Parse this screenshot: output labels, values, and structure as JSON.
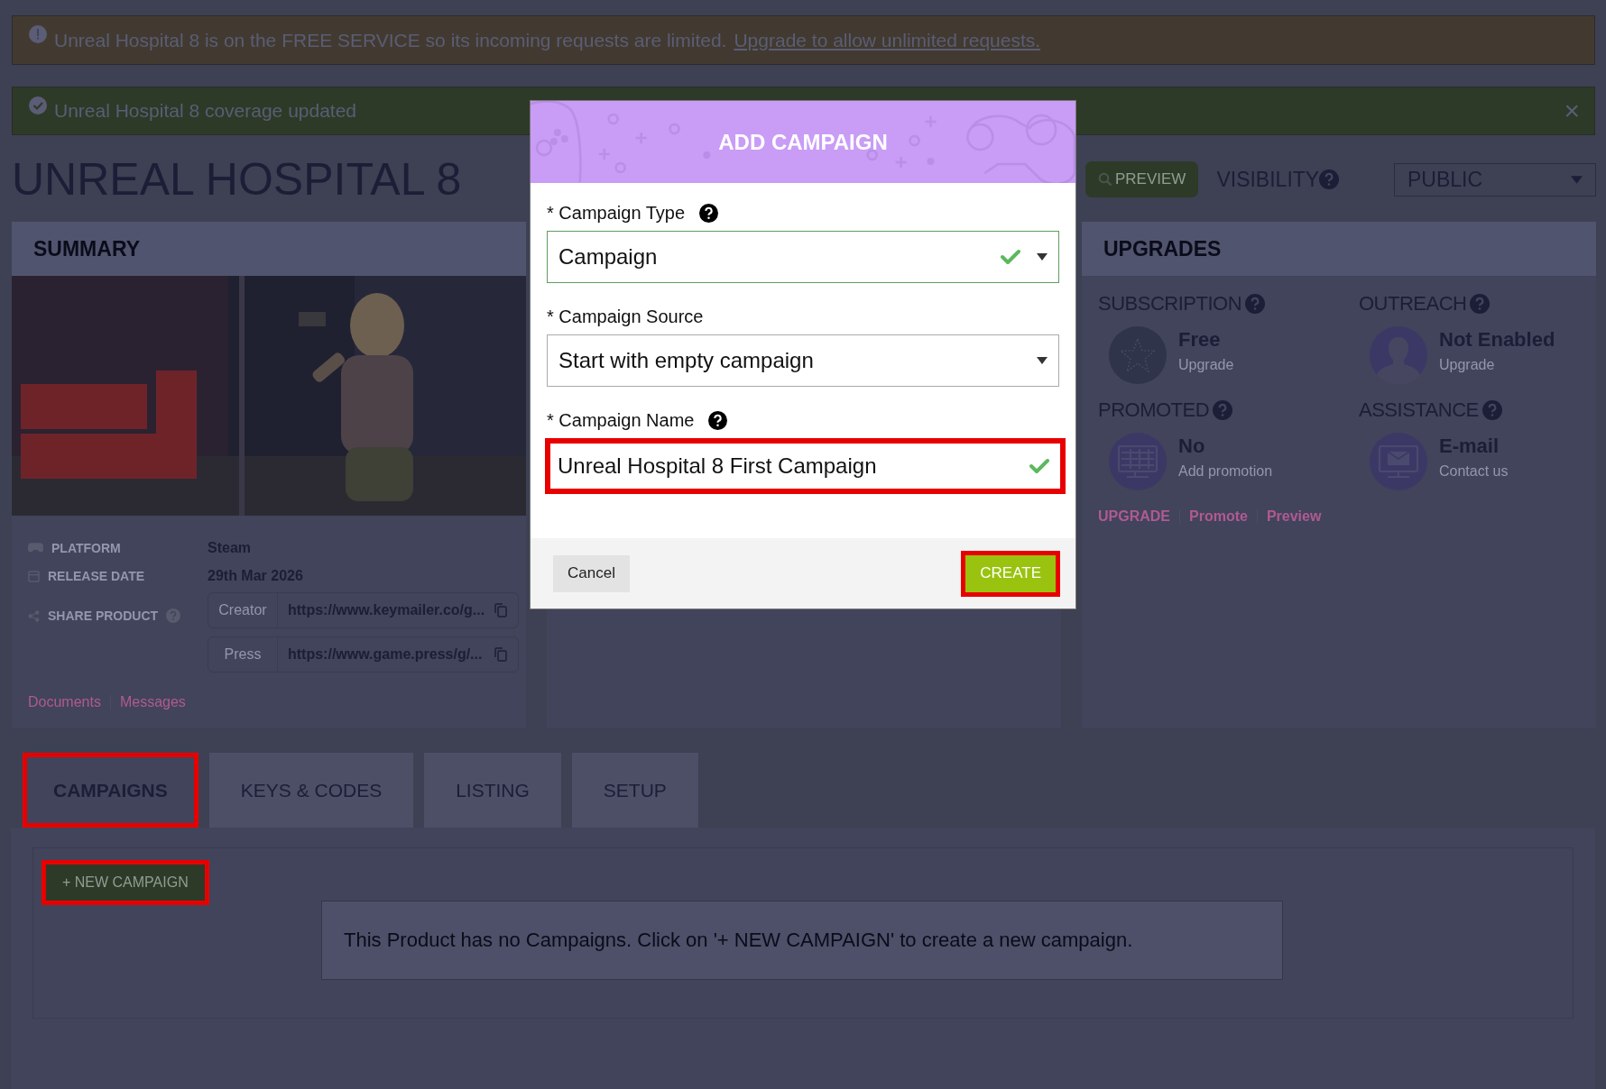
{
  "banners": [
    {
      "kind": "warning",
      "text": "Unreal Hospital 8 is on the FREE SERVICE so its incoming requests are limited.",
      "link": "Upgrade to allow unlimited requests."
    },
    {
      "kind": "success",
      "text": "Unreal Hospital 8 coverage updated",
      "close": "×"
    }
  ],
  "product": {
    "title": "UNREAL HOSPITAL 8",
    "preview_button": "PREVIEW",
    "visibility_label": "VISIBILITY",
    "visibility": "PUBLIC"
  },
  "summary": {
    "title": "SUMMARY",
    "picture": {
      "kind": "picture"
    },
    "details": [
      {
        "label": "PLATFORM",
        "value": "Steam"
      },
      {
        "label": "RELEASE DATE",
        "value": "29th Mar 2026"
      }
    ],
    "share": {
      "label": "SHARE PRODUCT",
      "links": [
        {
          "label": "Creator",
          "url": "https://www.keymailer.co/g..."
        },
        {
          "label": "Press",
          "url": "https://www.game.press/g/..."
        }
      ]
    },
    "links": [
      "Documents",
      "Messages"
    ]
  },
  "upgrades": {
    "title": "UPGRADES",
    "items": [
      {
        "heading": "SUBSCRIPTION",
        "value": "Free",
        "action": "Upgrade"
      },
      {
        "heading": "OUTREACH",
        "value": "Not Enabled",
        "action": "Upgrade"
      },
      {
        "heading": "PROMOTED",
        "value": "No",
        "action": "Add promotion"
      },
      {
        "heading": "ASSISTANCE",
        "value": "E-mail",
        "action": "Contact us"
      }
    ],
    "links": [
      "UPGRADE",
      "Promote",
      "Preview"
    ]
  },
  "tabs": [
    {
      "label": "CAMPAIGNS",
      "selected": true,
      "annotated": true
    },
    {
      "label": "KEYS & CODES",
      "selected": false,
      "annotated": false
    },
    {
      "label": "LISTING",
      "selected": false,
      "annotated": false
    },
    {
      "label": "SETUP",
      "selected": false,
      "annotated": false
    }
  ],
  "campaigns": {
    "new_button": "+ NEW CAMPAIGN",
    "new_button_annotated": true,
    "empty_message": "This Product has no Campaigns. Click on '+ NEW CAMPAIGN' to create a new campaign."
  },
  "dialog": {
    "title": "ADD CAMPAIGN",
    "fields": [
      {
        "kind": "select",
        "marker": "*",
        "label": "Campaign Type",
        "help": true,
        "value": "Campaign",
        "valid": true,
        "annotated": false
      },
      {
        "kind": "select",
        "marker": "*",
        "label": "Campaign Source",
        "help": false,
        "value": "Start with empty campaign",
        "valid": false,
        "annotated": false
      },
      {
        "kind": "text",
        "marker": "*",
        "label": "Campaign Name",
        "help": true,
        "value": "Unreal Hospital 8 First Campaign",
        "valid": true,
        "annotated": true
      }
    ],
    "buttons": [
      {
        "kind": "secondary",
        "label": "Cancel",
        "annotated": false
      },
      {
        "kind": "primary",
        "label": "CREATE",
        "annotated": true
      }
    ]
  }
}
